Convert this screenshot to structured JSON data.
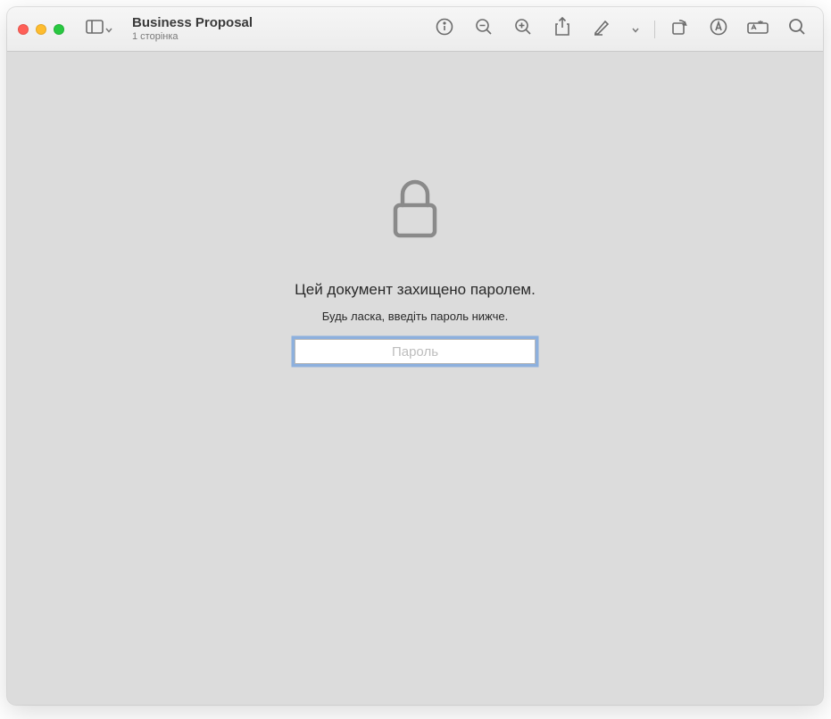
{
  "document": {
    "title": "Business Proposal",
    "subtitle": "1 сторінка"
  },
  "lock_prompt": {
    "heading": "Цей документ захищено паролем.",
    "subheading": "Будь ласка, введіть пароль нижче.",
    "placeholder": "Пароль"
  },
  "colors": {
    "focus_ring": "#4d8cde",
    "background": "#dcdcdc",
    "toolbar_bg": "#ececec"
  }
}
